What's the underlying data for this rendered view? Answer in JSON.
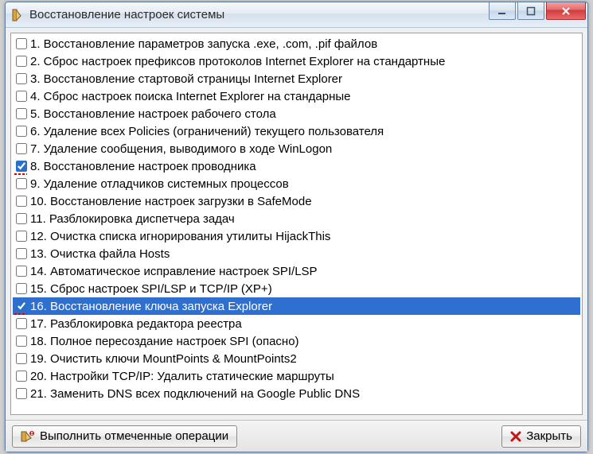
{
  "window": {
    "title": "Восстановление настроек системы"
  },
  "items": [
    {
      "n": "1",
      "label": "Восстановление параметров запуска .exe, .com, .pif файлов",
      "checked": false,
      "selected": false,
      "mark": false
    },
    {
      "n": "2",
      "label": "Сброс настроек префиксов протоколов Internet Explorer на стандартные",
      "checked": false,
      "selected": false,
      "mark": false
    },
    {
      "n": "3",
      "label": "Восстановление стартовой страницы Internet Explorer",
      "checked": false,
      "selected": false,
      "mark": false
    },
    {
      "n": "4",
      "label": "Сброс настроек поиска Internet Explorer на стандарные",
      "checked": false,
      "selected": false,
      "mark": false
    },
    {
      "n": "5",
      "label": "Восстановление настроек рабочего стола",
      "checked": false,
      "selected": false,
      "mark": false
    },
    {
      "n": "6",
      "label": "Удаление всех Policies (ограничений) текущего пользователя",
      "checked": false,
      "selected": false,
      "mark": false
    },
    {
      "n": "7",
      "label": "Удаление сообщения, выводимого в ходе WinLogon",
      "checked": false,
      "selected": false,
      "mark": false
    },
    {
      "n": "8",
      "label": "Восстановление настроек проводника",
      "checked": true,
      "selected": false,
      "mark": true
    },
    {
      "n": "9",
      "label": "Удаление отладчиков системных процессов",
      "checked": false,
      "selected": false,
      "mark": false
    },
    {
      "n": "10",
      "label": "Восстановление настроек загрузки в SafeMode",
      "checked": false,
      "selected": false,
      "mark": false
    },
    {
      "n": "11",
      "label": "Разблокировка диспетчера задач",
      "checked": false,
      "selected": false,
      "mark": false
    },
    {
      "n": "12",
      "label": "Очистка списка игнорирования утилиты HijackThis",
      "checked": false,
      "selected": false,
      "mark": false
    },
    {
      "n": "13",
      "label": "Очистка файла Hosts",
      "checked": false,
      "selected": false,
      "mark": false
    },
    {
      "n": "14",
      "label": "Автоматическое исправление настроек SPI/LSP",
      "checked": false,
      "selected": false,
      "mark": false
    },
    {
      "n": "15",
      "label": "Сброс настроек SPI/LSP и TCP/IP (XP+)",
      "checked": false,
      "selected": false,
      "mark": false
    },
    {
      "n": "16",
      "label": "Восстановление ключа запуска Explorer",
      "checked": true,
      "selected": true,
      "mark": true
    },
    {
      "n": "17",
      "label": "Разблокировка редактора реестра",
      "checked": false,
      "selected": false,
      "mark": false
    },
    {
      "n": "18",
      "label": "Полное пересоздание настроек SPI (опасно)",
      "checked": false,
      "selected": false,
      "mark": false
    },
    {
      "n": "19",
      "label": "Очистить ключи MountPoints & MountPoints2",
      "checked": false,
      "selected": false,
      "mark": false
    },
    {
      "n": "20",
      "label": "Настройки TCP/IP: Удалить статические маршруты",
      "checked": false,
      "selected": false,
      "mark": false
    },
    {
      "n": "21",
      "label": "Заменить DNS всех подключений на Google Public DNS",
      "checked": false,
      "selected": false,
      "mark": false
    }
  ],
  "footer": {
    "execute_label": "Выполнить отмеченные операции",
    "close_label": "Закрыть"
  }
}
